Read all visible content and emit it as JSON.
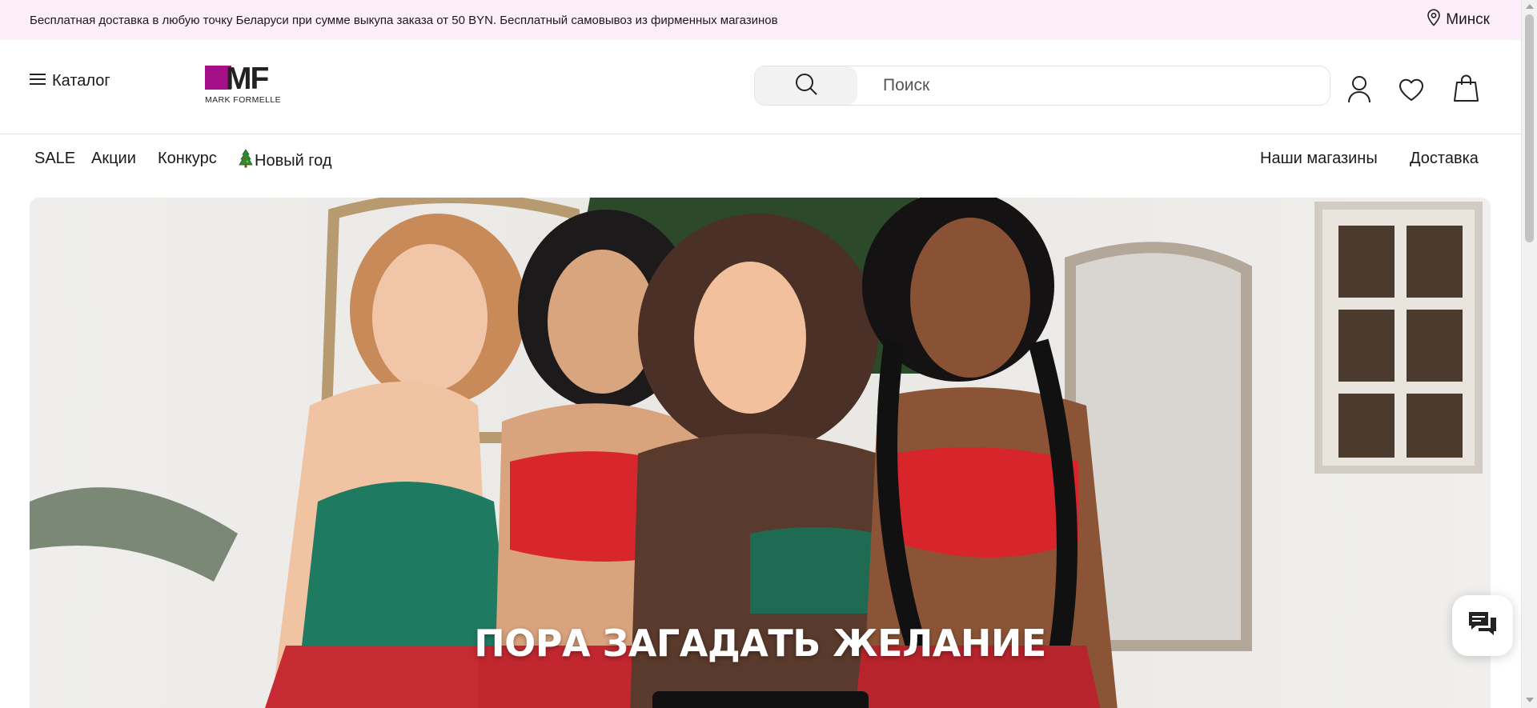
{
  "promo": {
    "text": "Бесплатная доставка в любую точку Беларуси при сумме выкупа заказа от 50 BYN. Бесплатный самовывоз из фирменных магазинов",
    "city": "Минск"
  },
  "header": {
    "catalog_label": "Каталог",
    "logo": {
      "mark": "MF",
      "name": "MARK FORMELLE",
      "accent_color": "#a50f88"
    },
    "search": {
      "placeholder": "Поиск",
      "value": ""
    },
    "icons": [
      "user-icon",
      "heart-icon",
      "bag-icon"
    ]
  },
  "nav": {
    "left": [
      "SALE",
      "Акции",
      "Конкурс",
      "Новый год"
    ],
    "right": [
      "Наши магазины",
      "Доставка"
    ]
  },
  "hero": {
    "title": "ПОРА ЗАГАДАТЬ ЖЕЛАНИЕ"
  },
  "colors": {
    "promo_bg": "#fdeefb",
    "text": "#1a1a1a",
    "brand": "#a50f88"
  }
}
